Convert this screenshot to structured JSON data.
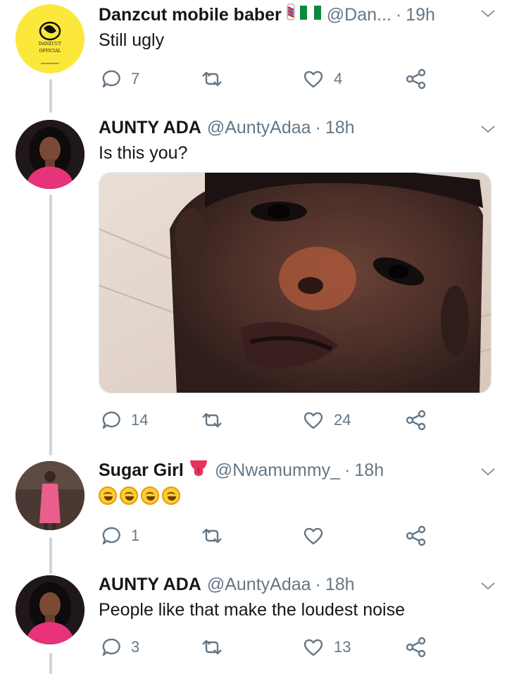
{
  "colors": {
    "meta": "#657786",
    "line": "#ccd6dd",
    "text": "#14171a"
  },
  "tweets": [
    {
      "name": "Danzcut mobile baber",
      "handle": "@Dan...",
      "time": "19h",
      "text": "Still ugly",
      "avatar_text": [
        "DANZCUT",
        "OFFICIAL"
      ],
      "replies": "7",
      "retweets": "",
      "likes": "4",
      "badges": [
        "barber-pole-emoji",
        "nigeria-flag-emoji"
      ]
    },
    {
      "name": "AUNTY ADA",
      "handle": "@AuntyAdaa",
      "time": "18h",
      "text": "Is this you?",
      "replies": "14",
      "retweets": "",
      "likes": "24",
      "has_photo": true
    },
    {
      "name": "Sugar Girl",
      "handle": "@Nwamummy_",
      "time": "18h",
      "text": "",
      "emojis": [
        "rofl-emoji",
        "rofl-emoji",
        "rofl-emoji",
        "rofl-emoji"
      ],
      "replies": "1",
      "retweets": "",
      "likes": "",
      "badges": [
        "tongue-emoji"
      ]
    },
    {
      "name": "AUNTY ADA",
      "handle": "@AuntyAdaa",
      "time": "18h",
      "text": "People like that make the loudest noise",
      "replies": "3",
      "retweets": "",
      "likes": "13"
    }
  ]
}
